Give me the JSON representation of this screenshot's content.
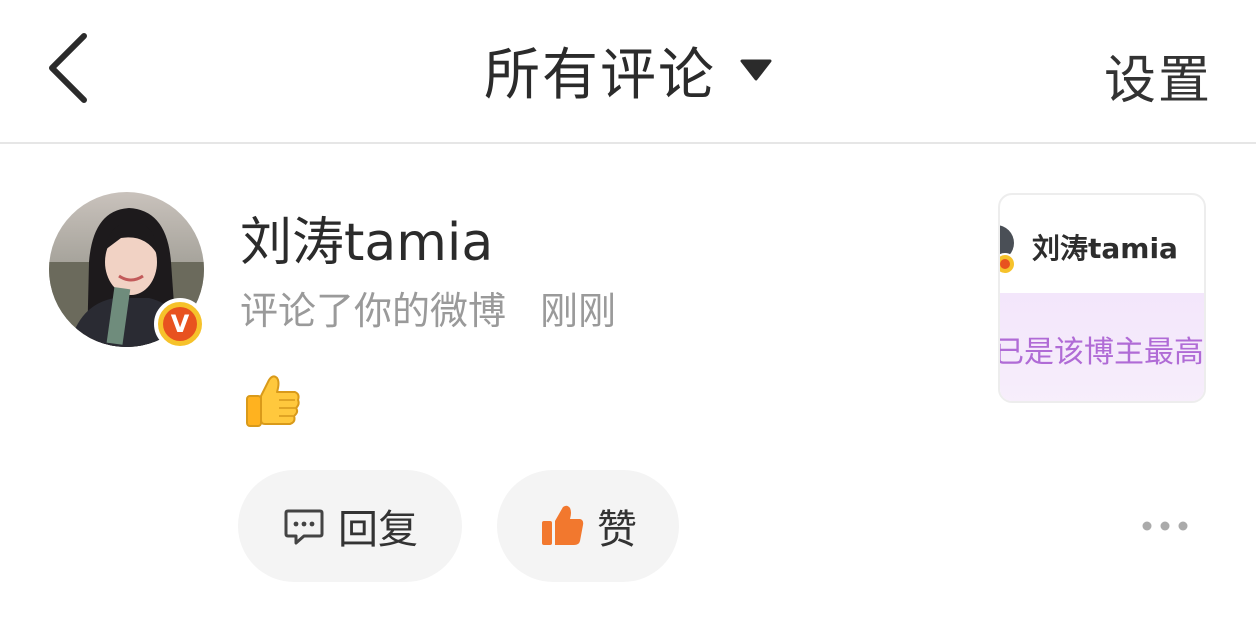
{
  "header": {
    "title": "所有评论",
    "settings_label": "设置"
  },
  "comment": {
    "username": "刘涛tamia",
    "action": "评论了你的微博",
    "time": "刚刚",
    "badge": "V",
    "content_emoji": "thumbs-up"
  },
  "actions": {
    "reply_label": "回复",
    "like_label": "赞"
  },
  "preview_card": {
    "name": "刘涛tamia",
    "text": "已是该博主最高等"
  },
  "colors": {
    "badge_ring": "#f6c22b",
    "badge_inner": "#e8521f",
    "like_icon": "#f2782e",
    "card_text": "#b06bd6",
    "card_bg": "#f3e6fb"
  }
}
